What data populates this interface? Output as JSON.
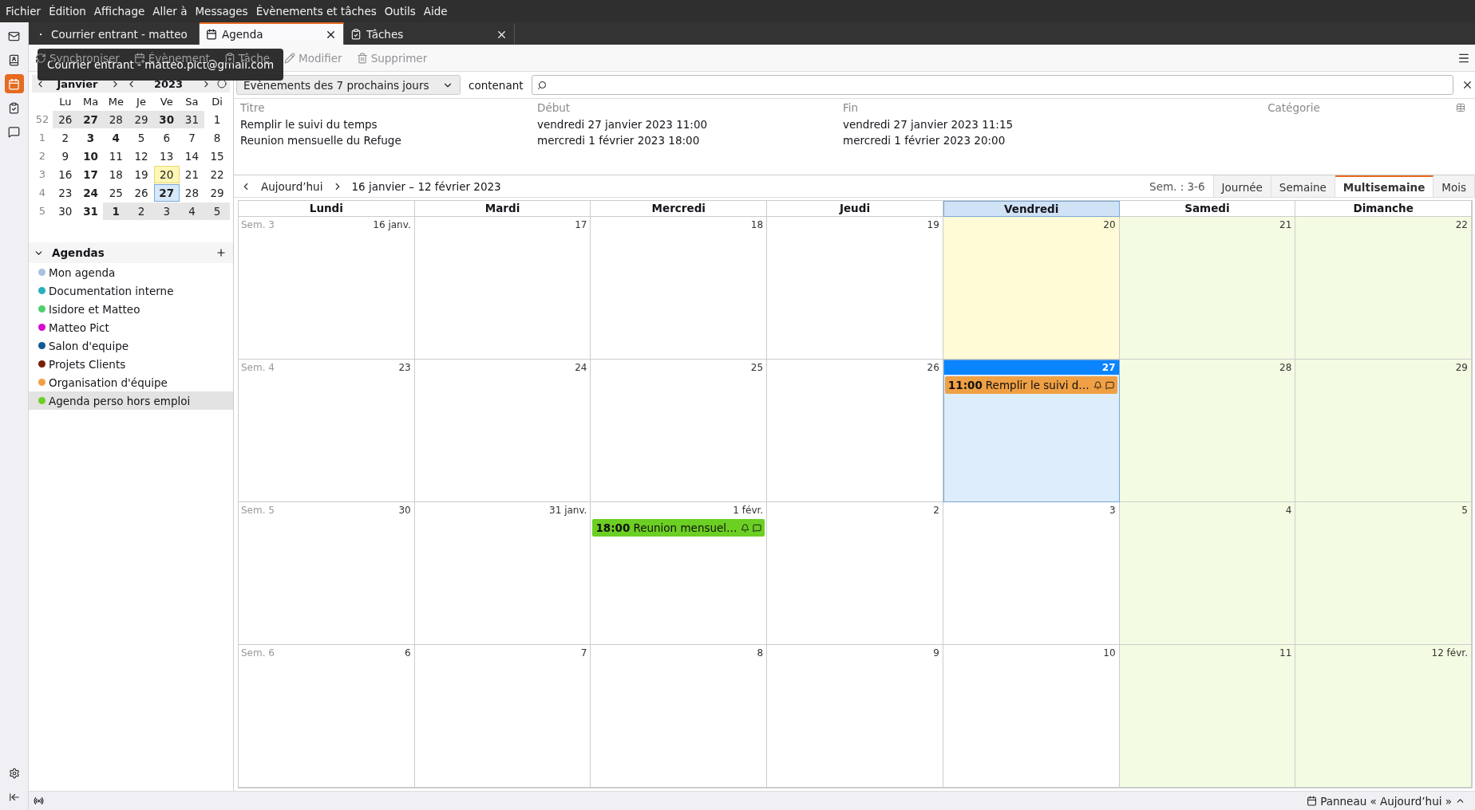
{
  "menu": [
    "Fichier",
    "Édition",
    "Affichage",
    "Aller à",
    "Messages",
    "Évènements et tâches",
    "Outils",
    "Aide"
  ],
  "spaces": [
    {
      "kind": "mail",
      "selected": false
    },
    {
      "kind": "contacts",
      "selected": false
    },
    {
      "kind": "calendar",
      "selected": true
    },
    {
      "kind": "tasks",
      "selected": false
    },
    {
      "kind": "chat",
      "selected": false
    }
  ],
  "tabs": [
    {
      "label": "Courrier entrant - matteo",
      "kind": "mail",
      "selected": false,
      "closable": false
    },
    {
      "label": "Agenda",
      "kind": "calendar",
      "selected": true,
      "closable": true
    },
    {
      "label": "Tâches",
      "kind": "tasks",
      "selected": false,
      "closable": true
    }
  ],
  "toolbar": [
    {
      "label": "Synchroniser",
      "kind": "sync",
      "disabled": false
    },
    {
      "label": "Évènement",
      "kind": "event",
      "disabled": false
    },
    {
      "label": "Tâche",
      "kind": "task",
      "disabled": false
    },
    {
      "label": "Modifier",
      "kind": "edit",
      "disabled": true
    },
    {
      "label": "Supprimer",
      "kind": "delete",
      "disabled": true
    }
  ],
  "tooltip": "Courrier entrant - matteo.pict@gmail.com",
  "minical": {
    "month": "Janvier",
    "year": "2023",
    "weekdays": [
      "Lu",
      "Ma",
      "Me",
      "Je",
      "Ve",
      "Sa",
      "Di"
    ],
    "weeks": [
      {
        "number": "52",
        "days": [
          {
            "label": "26",
            "other_month": true,
            "bold": false,
            "today": false,
            "selected": false
          },
          {
            "label": "27",
            "other_month": true,
            "bold": true,
            "today": false,
            "selected": false
          },
          {
            "label": "28",
            "other_month": true,
            "bold": false,
            "today": false,
            "selected": false
          },
          {
            "label": "29",
            "other_month": true,
            "bold": false,
            "today": false,
            "selected": false
          },
          {
            "label": "30",
            "other_month": true,
            "bold": true,
            "today": false,
            "selected": false
          },
          {
            "label": "31",
            "other_month": true,
            "bold": false,
            "today": false,
            "selected": false
          },
          {
            "label": "1",
            "other_month": false,
            "bold": false,
            "today": false,
            "selected": false
          }
        ]
      },
      {
        "number": "1",
        "days": [
          {
            "label": "2",
            "other_month": false,
            "bold": false,
            "today": false,
            "selected": false
          },
          {
            "label": "3",
            "other_month": false,
            "bold": true,
            "today": false,
            "selected": false
          },
          {
            "label": "4",
            "other_month": false,
            "bold": true,
            "today": false,
            "selected": false
          },
          {
            "label": "5",
            "other_month": false,
            "bold": false,
            "today": false,
            "selected": false
          },
          {
            "label": "6",
            "other_month": false,
            "bold": false,
            "today": false,
            "selected": false
          },
          {
            "label": "7",
            "other_month": false,
            "bold": false,
            "today": false,
            "selected": false
          },
          {
            "label": "8",
            "other_month": false,
            "bold": false,
            "today": false,
            "selected": false
          }
        ]
      },
      {
        "number": "2",
        "days": [
          {
            "label": "9",
            "other_month": false,
            "bold": false,
            "today": false,
            "selected": false
          },
          {
            "label": "10",
            "other_month": false,
            "bold": true,
            "today": false,
            "selected": false
          },
          {
            "label": "11",
            "other_month": false,
            "bold": false,
            "today": false,
            "selected": false
          },
          {
            "label": "12",
            "other_month": false,
            "bold": false,
            "today": false,
            "selected": false
          },
          {
            "label": "13",
            "other_month": false,
            "bold": false,
            "today": false,
            "selected": false
          },
          {
            "label": "14",
            "other_month": false,
            "bold": false,
            "today": false,
            "selected": false
          },
          {
            "label": "15",
            "other_month": false,
            "bold": false,
            "today": false,
            "selected": false
          }
        ]
      },
      {
        "number": "3",
        "days": [
          {
            "label": "16",
            "other_month": false,
            "bold": false,
            "today": false,
            "selected": false
          },
          {
            "label": "17",
            "other_month": false,
            "bold": true,
            "today": false,
            "selected": false
          },
          {
            "label": "18",
            "other_month": false,
            "bold": false,
            "today": false,
            "selected": false
          },
          {
            "label": "19",
            "other_month": false,
            "bold": false,
            "today": false,
            "selected": false
          },
          {
            "label": "20",
            "other_month": false,
            "bold": false,
            "today": true,
            "selected": false
          },
          {
            "label": "21",
            "other_month": false,
            "bold": false,
            "today": false,
            "selected": false
          },
          {
            "label": "22",
            "other_month": false,
            "bold": false,
            "today": false,
            "selected": false
          }
        ]
      },
      {
        "number": "4",
        "days": [
          {
            "label": "23",
            "other_month": false,
            "bold": false,
            "today": false,
            "selected": false
          },
          {
            "label": "24",
            "other_month": false,
            "bold": true,
            "today": false,
            "selected": false
          },
          {
            "label": "25",
            "other_month": false,
            "bold": false,
            "today": false,
            "selected": false
          },
          {
            "label": "26",
            "other_month": false,
            "bold": false,
            "today": false,
            "selected": false
          },
          {
            "label": "27",
            "other_month": false,
            "bold": true,
            "today": false,
            "selected": true
          },
          {
            "label": "28",
            "other_month": false,
            "bold": false,
            "today": false,
            "selected": false
          },
          {
            "label": "29",
            "other_month": false,
            "bold": false,
            "today": false,
            "selected": false
          }
        ]
      },
      {
        "number": "5",
        "days": [
          {
            "label": "30",
            "other_month": false,
            "bold": false,
            "today": false,
            "selected": false
          },
          {
            "label": "31",
            "other_month": false,
            "bold": true,
            "today": false,
            "selected": false
          },
          {
            "label": "1",
            "other_month": true,
            "bold": true,
            "today": false,
            "selected": false
          },
          {
            "label": "2",
            "other_month": true,
            "bold": false,
            "today": false,
            "selected": false
          },
          {
            "label": "3",
            "other_month": true,
            "bold": false,
            "today": false,
            "selected": false
          },
          {
            "label": "4",
            "other_month": true,
            "bold": false,
            "today": false,
            "selected": false
          },
          {
            "label": "5",
            "other_month": true,
            "bold": false,
            "today": false,
            "selected": false
          }
        ]
      }
    ]
  },
  "agendas": {
    "title": "Agendas",
    "expanded": true,
    "items": [
      {
        "name": "Mon agenda",
        "color": "#a8c2e0",
        "selected": false
      },
      {
        "name": "Documentation interne",
        "color": "#2ab0bc",
        "selected": false
      },
      {
        "name": "Isidore et Matteo",
        "color": "#4fd06e",
        "selected": false
      },
      {
        "name": "Matteo Pict",
        "color": "#d70ad0",
        "selected": false
      },
      {
        "name": "Salon d'equipe",
        "color": "#0e5a93",
        "selected": false
      },
      {
        "name": "Projets Clients",
        "color": "#7a1e08",
        "selected": false
      },
      {
        "name": "Organisation d'équipe",
        "color": "#f0a044",
        "selected": false
      },
      {
        "name": "Agenda perso hors emploi",
        "color": "#6ccf23",
        "selected": true
      }
    ]
  },
  "filter": {
    "range": "Évènements des 7 prochains jours",
    "label": "contenant"
  },
  "event_list": {
    "columns": [
      "Titre",
      "Début",
      "Fin",
      "Catégorie"
    ],
    "rows": [
      {
        "title": "Remplir le suivi du temps",
        "start": "vendredi 27 janvier 2023 11:00",
        "end": "vendredi 27 janvier 2023 11:15"
      },
      {
        "title": "Reunion mensuelle du Refuge",
        "start": "mercredi 1 février 2023 18:00",
        "end": "mercredi 1 février 2023 20:00"
      }
    ]
  },
  "nav": {
    "today": "Aujourd’hui",
    "range": "16 janvier – 12 février 2023",
    "weeks": "Sem. : 3-6"
  },
  "views": [
    {
      "label": "Journée",
      "selected": false
    },
    {
      "label": "Semaine",
      "selected": false
    },
    {
      "label": "Multisemaine",
      "selected": true
    },
    {
      "label": "Mois",
      "selected": false
    }
  ],
  "grid": {
    "headers": [
      {
        "label": "Lundi",
        "selected": false
      },
      {
        "label": "Mardi",
        "selected": false
      },
      {
        "label": "Mercredi",
        "selected": false
      },
      {
        "label": "Jeudi",
        "selected": false
      },
      {
        "label": "Vendredi",
        "selected": true
      },
      {
        "label": "Samedi",
        "selected": false
      },
      {
        "label": "Dimanche",
        "selected": false
      }
    ],
    "weeks": [
      {
        "label": "Sem. 3",
        "days": [
          {
            "label": "16 janv.",
            "weekend": false,
            "today": false,
            "selected": false
          },
          {
            "label": "17",
            "weekend": false,
            "today": false,
            "selected": false
          },
          {
            "label": "18",
            "weekend": false,
            "today": false,
            "selected": false
          },
          {
            "label": "19",
            "weekend": false,
            "today": false,
            "selected": false
          },
          {
            "label": "20",
            "weekend": false,
            "today": true,
            "selected": false
          },
          {
            "label": "21",
            "weekend": true,
            "today": false,
            "selected": false
          },
          {
            "label": "22",
            "weekend": true,
            "today": false,
            "selected": false
          }
        ]
      },
      {
        "label": "Sem. 4",
        "days": [
          {
            "label": "23",
            "weekend": false,
            "today": false,
            "selected": false
          },
          {
            "label": "24",
            "weekend": false,
            "today": false,
            "selected": false
          },
          {
            "label": "25",
            "weekend": false,
            "today": false,
            "selected": false
          },
          {
            "label": "26",
            "weekend": false,
            "today": false,
            "selected": false
          },
          {
            "label": "27",
            "weekend": false,
            "today": false,
            "selected": true,
            "events": [
              {
                "time": "11:00",
                "title": "Remplir le suivi d…",
                "color": "#f0a044"
              }
            ]
          },
          {
            "label": "28",
            "weekend": true,
            "today": false,
            "selected": false
          },
          {
            "label": "29",
            "weekend": true,
            "today": false,
            "selected": false
          }
        ]
      },
      {
        "label": "Sem. 5",
        "days": [
          {
            "label": "30",
            "weekend": false,
            "today": false,
            "selected": false
          },
          {
            "label": "31 janv.",
            "weekend": false,
            "today": false,
            "selected": false
          },
          {
            "label": "1 févr.",
            "weekend": false,
            "today": false,
            "selected": false,
            "events": [
              {
                "time": "18:00",
                "title": "Reunion mensuel…",
                "color": "#6ccf23"
              }
            ]
          },
          {
            "label": "2",
            "weekend": false,
            "today": false,
            "selected": false
          },
          {
            "label": "3",
            "weekend": false,
            "today": false,
            "selected": false
          },
          {
            "label": "4",
            "weekend": true,
            "today": false,
            "selected": false
          },
          {
            "label": "5",
            "weekend": true,
            "today": false,
            "selected": false
          }
        ]
      },
      {
        "label": "Sem. 6",
        "days": [
          {
            "label": "6",
            "weekend": false,
            "today": false,
            "selected": false
          },
          {
            "label": "7",
            "weekend": false,
            "today": false,
            "selected": false
          },
          {
            "label": "8",
            "weekend": false,
            "today": false,
            "selected": false
          },
          {
            "label": "9",
            "weekend": false,
            "today": false,
            "selected": false
          },
          {
            "label": "10",
            "weekend": false,
            "today": false,
            "selected": false
          },
          {
            "label": "11",
            "weekend": true,
            "today": false,
            "selected": false
          },
          {
            "label": "12 févr.",
            "weekend": true,
            "today": false,
            "selected": false
          }
        ]
      }
    ]
  },
  "status": {
    "today_pane": "Panneau « Aujourd’hui »"
  }
}
